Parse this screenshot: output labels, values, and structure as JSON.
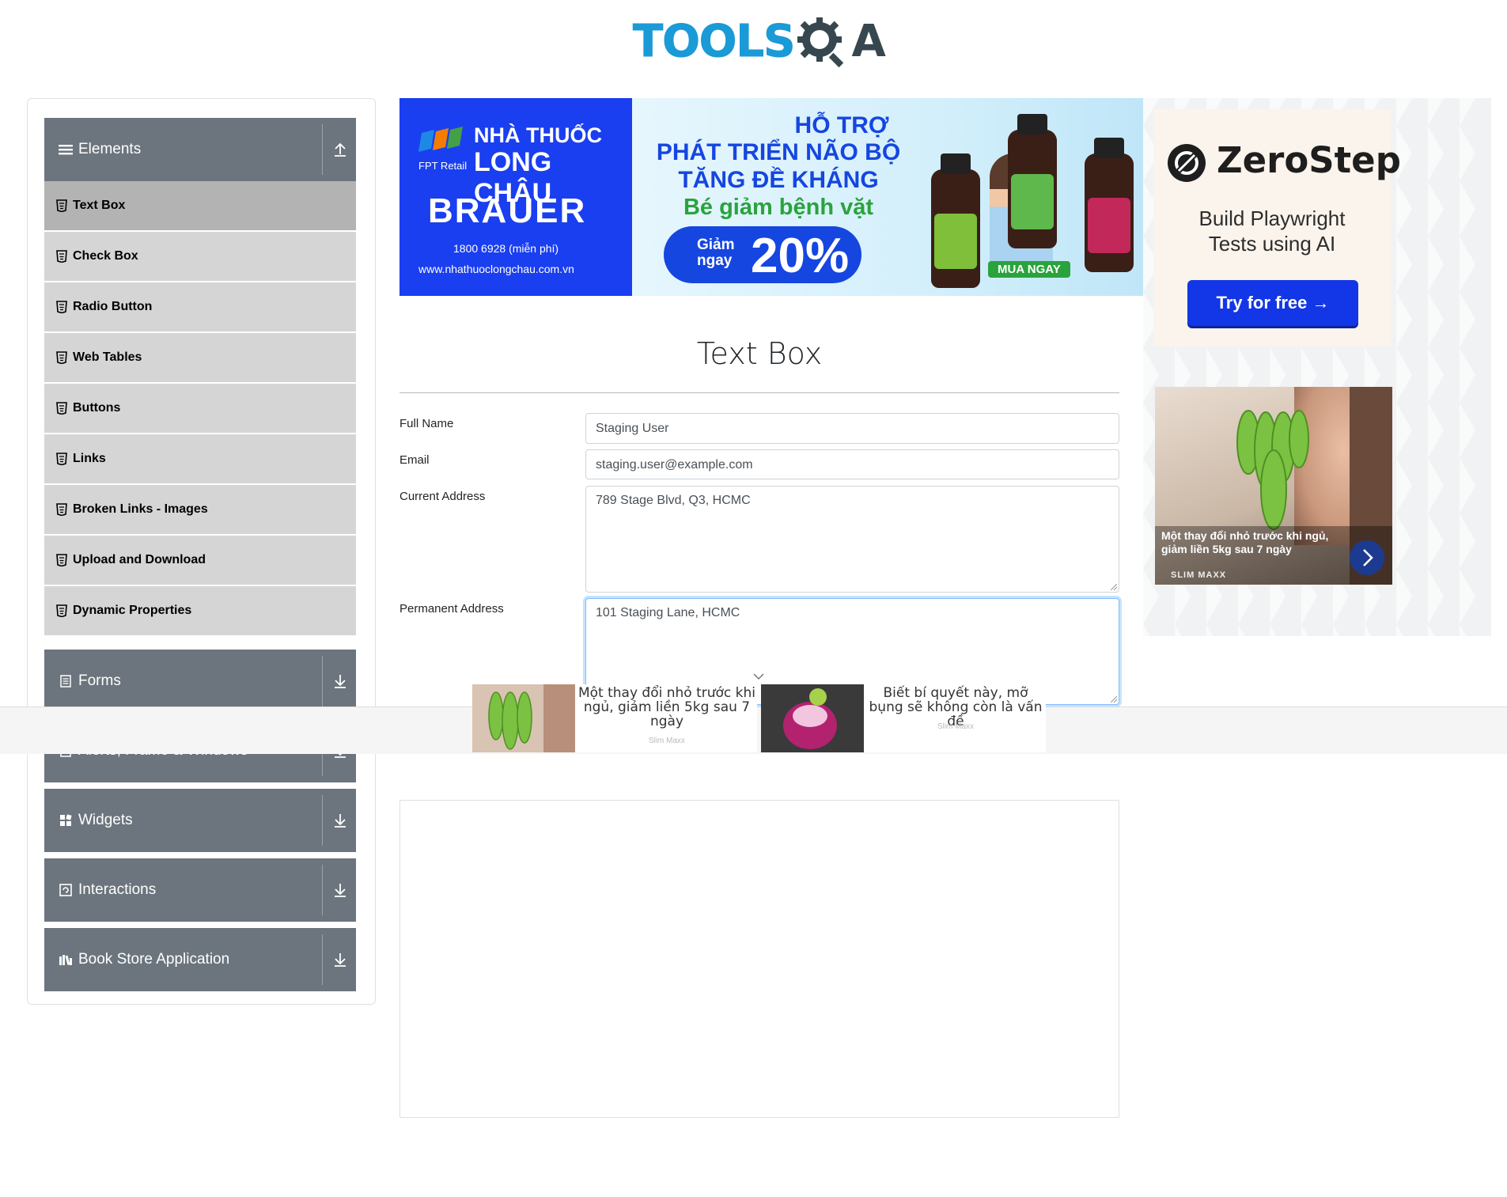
{
  "header": {
    "logo_text": "TOOLSQA"
  },
  "sidebar": {
    "groups": [
      {
        "label": "Elements",
        "icon": "hamburger-icon",
        "expanded": true
      },
      {
        "label": "Forms",
        "icon": "form-icon",
        "expanded": false
      },
      {
        "label": "Alerts, Frame & Windows",
        "icon": "alert-icon",
        "expanded": false
      },
      {
        "label": "Widgets",
        "icon": "widgets-icon",
        "expanded": false
      },
      {
        "label": "Interactions",
        "icon": "interactions-icon",
        "expanded": false
      },
      {
        "label": "Book Store Application",
        "icon": "book-icon",
        "expanded": false
      }
    ],
    "items": [
      {
        "label": "Text Box",
        "active": true
      },
      {
        "label": "Check Box"
      },
      {
        "label": "Radio Button"
      },
      {
        "label": "Web Tables"
      },
      {
        "label": "Buttons"
      },
      {
        "label": "Links"
      },
      {
        "label": "Broken Links - Images"
      },
      {
        "label": "Upload and Download"
      },
      {
        "label": "Dynamic Properties"
      }
    ]
  },
  "banner": {
    "brand_line1": "NHÀ THUỐC",
    "brand_line2": "LONG CHÂU",
    "fpt": "FPT Retail",
    "product": "BRAUER",
    "phone": "1800 6928 (miễn phí)",
    "site": "www.nhathuoclongchau.com.vn",
    "headline1": "HỖ TRỢ",
    "headline2": "PHÁT TRIỂN NÃO BỘ",
    "headline3": "TĂNG ĐỀ KHÁNG",
    "headline4": "Bé giảm bệnh vặt",
    "discount_label": "Giảm ngay",
    "discount_value": "20%",
    "cta": "MUA NGAY"
  },
  "side_ad": {
    "brand": "ZeroStep",
    "tagline": "Build Playwright Tests using AI",
    "cta": "Try for free →",
    "video_caption": "Một thay đổi nhỏ trước khi ngủ, giảm liền 5kg sau 7 ngày",
    "video_brand": "SLIM MAXX"
  },
  "main": {
    "title": "Text Box",
    "fields": {
      "full_name": {
        "label": "Full Name",
        "value": "Staging User"
      },
      "email": {
        "label": "Email",
        "value": "staging.user@example.com"
      },
      "current_address": {
        "label": "Current Address",
        "value": "789 Stage Blvd, Q3, HCMC"
      },
      "permanent_address": {
        "label": "Permanent Address",
        "value": "101 Staging Lane, HCMC"
      }
    }
  },
  "anchor_ad": {
    "cards": [
      {
        "text": "Một thay đổi nhỏ trước khi ngủ, giảm liền 5kg sau 7 ngày",
        "source": "Slim Maxx"
      },
      {
        "text": "Biết bí quyết này, mỡ bụng sẽ không còn là vấn đề",
        "source": "Slim Maxx"
      }
    ]
  },
  "colors": {
    "sidebar_header": "#6c757d",
    "menu_item": "#d5d5d5",
    "menu_item_active": "#b3b3b3",
    "logo_blue": "#1a9ad6",
    "focus_border": "#80bdff"
  }
}
